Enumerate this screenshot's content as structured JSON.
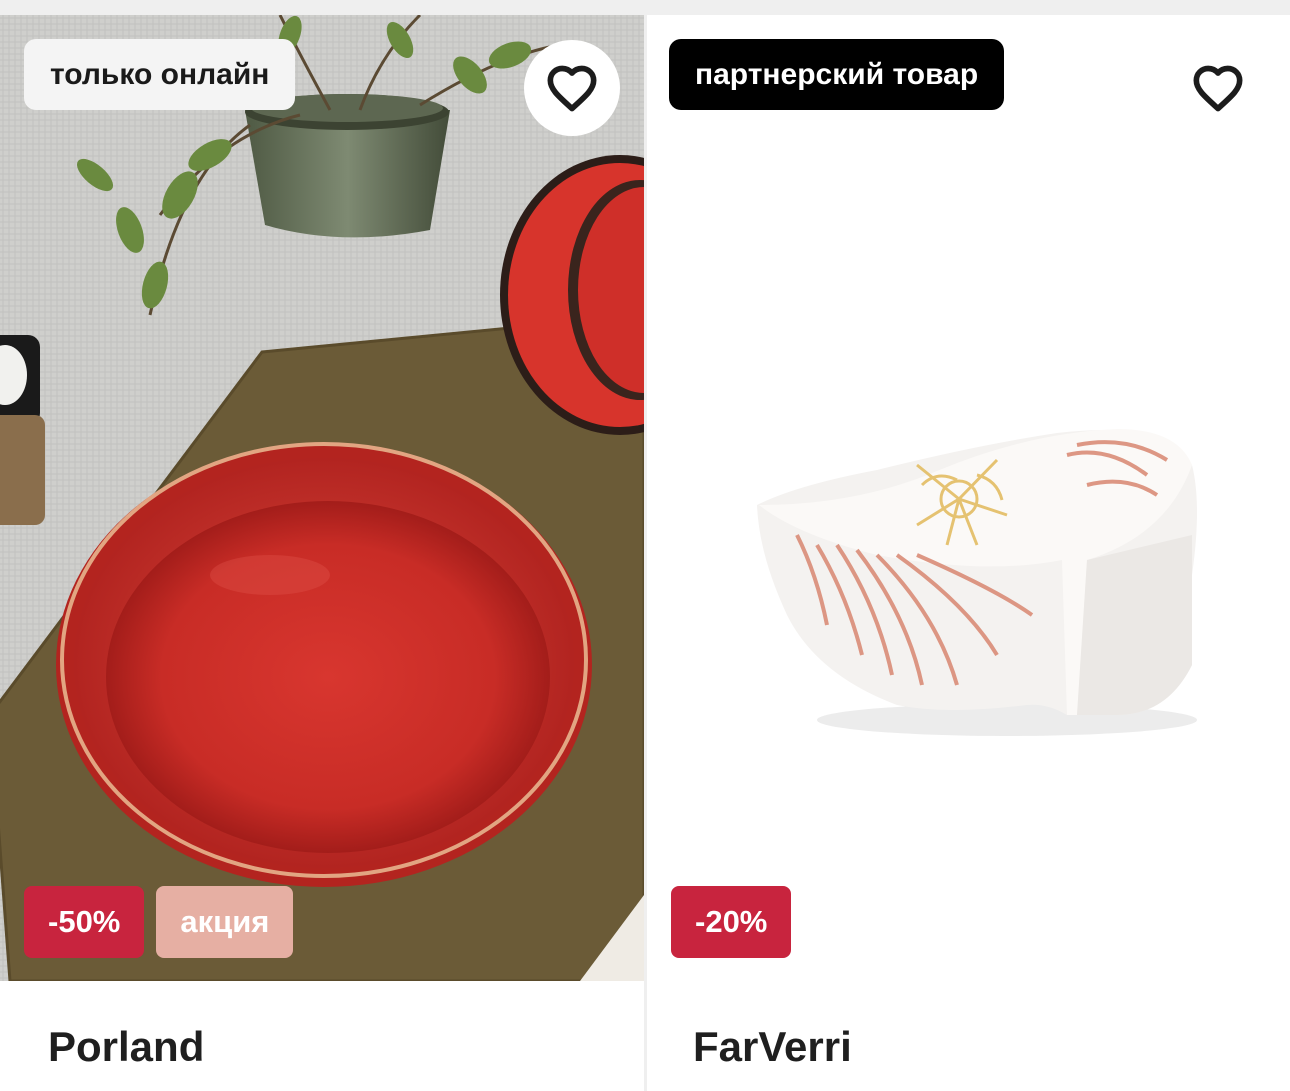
{
  "products": [
    {
      "badge": "только онлайн",
      "discount": "-50%",
      "promo": "акция",
      "brand": "Porland",
      "favorite_icon": "heart-outline-icon"
    },
    {
      "badge": "партнерский товар",
      "discount": "-20%",
      "brand": "FarVerri",
      "favorite_icon": "heart-outline-icon"
    }
  ],
  "colors": {
    "discount_badge": "#c8243e",
    "promo_badge": "#e6afa3",
    "partner_badge": "#000000",
    "online_badge": "#f4f4f4"
  }
}
